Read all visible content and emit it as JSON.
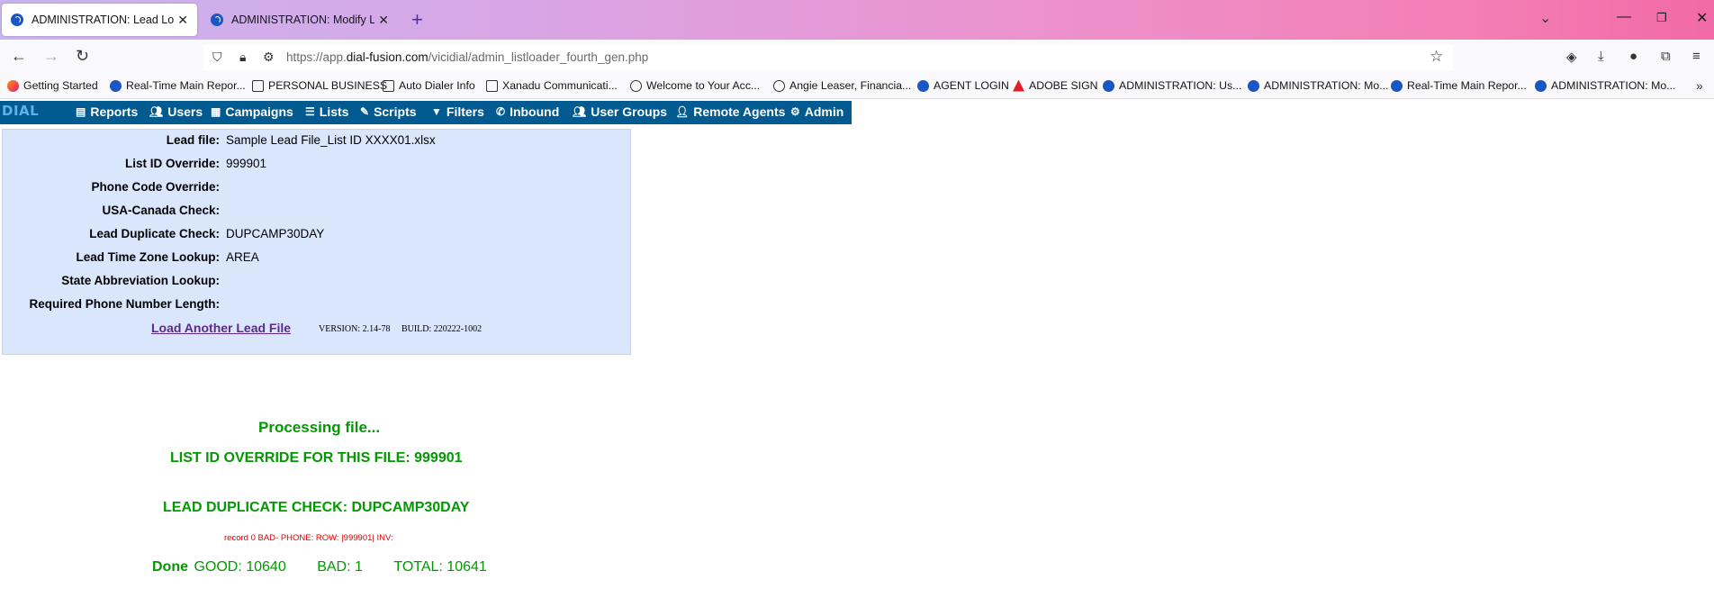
{
  "browser": {
    "tabs": [
      {
        "title": "ADMINISTRATION: Lead Loader",
        "active": true
      },
      {
        "title": "ADMINISTRATION: Modify List",
        "active": false
      }
    ],
    "url_prefix": "https://app.",
    "url_domain": "dial-fusion.com",
    "url_path": "/vicidial/admin_listloader_fourth_gen.php",
    "bookmarks": [
      {
        "label": "Getting Started",
        "icon": "firefox-icon"
      },
      {
        "label": "Real-Time Main Repor...",
        "icon": "dial-icon"
      },
      {
        "label": "PERSONAL BUSINESS",
        "icon": "folder-icon"
      },
      {
        "label": "Auto Dialer Info",
        "icon": "folder-icon"
      },
      {
        "label": "Xanadu Communicati...",
        "icon": "folder-icon"
      },
      {
        "label": "Welcome to Your Acc...",
        "icon": "globe-icon"
      },
      {
        "label": "Angie Leaser, Financia...",
        "icon": "globe-icon"
      },
      {
        "label": "AGENT LOGIN",
        "icon": "dial-icon"
      },
      {
        "label": "ADOBE SIGN",
        "icon": "adobe-icon"
      },
      {
        "label": "ADMINISTRATION: Us...",
        "icon": "dial-icon"
      },
      {
        "label": "ADMINISTRATION: Mo...",
        "icon": "dial-icon"
      },
      {
        "label": "Real-Time Main Repor...",
        "icon": "dial-icon"
      },
      {
        "label": "ADMINISTRATION: Mo...",
        "icon": "dial-icon"
      }
    ]
  },
  "app_menu": {
    "logo": "DIAL",
    "items": [
      {
        "label": "Reports",
        "icon": "reports-icon"
      },
      {
        "label": "Users",
        "icon": "users-icon"
      },
      {
        "label": "Campaigns",
        "icon": "campaigns-icon"
      },
      {
        "label": "Lists",
        "icon": "lists-icon"
      },
      {
        "label": "Scripts",
        "icon": "scripts-icon"
      },
      {
        "label": "Filters",
        "icon": "filter-icon"
      },
      {
        "label": "Inbound",
        "icon": "inbound-icon"
      },
      {
        "label": "User Groups",
        "icon": "user-groups-icon"
      },
      {
        "label": "Remote Agents",
        "icon": "remote-agents-icon"
      },
      {
        "label": "Admin",
        "icon": "gear-icon"
      }
    ]
  },
  "summary": {
    "rows": [
      {
        "label": "Lead file:",
        "value": "Sample Lead File_List ID XXXX01.xlsx"
      },
      {
        "label": "List ID Override:",
        "value": "999901"
      },
      {
        "label": "Phone Code Override:",
        "value": ""
      },
      {
        "label": "USA-Canada Check:",
        "value": ""
      },
      {
        "label": "Lead Duplicate Check:",
        "value": "DUPCAMP30DAY"
      },
      {
        "label": "Lead Time Zone Lookup:",
        "value": "AREA"
      },
      {
        "label": "State Abbreviation Lookup:",
        "value": ""
      },
      {
        "label": "Required Phone Number Length:",
        "value": ""
      }
    ],
    "load_another_link": "Load Another Lead File",
    "version_text": "VERSION: 2.14-78     BUILD: 220222-1002"
  },
  "results": {
    "processing": "Processing file...",
    "override": "LIST ID OVERRIDE FOR THIS FILE: 999901",
    "duplicate": "LEAD DUPLICATE CHECK: DUPCAMP30DAY",
    "bad_record": "record 0 BAD- PHONE: ROW: |999901| INV:",
    "done_label": "Done",
    "good": "GOOD: 10640",
    "bad": "BAD: 1",
    "total": "TOTAL: 10641"
  }
}
